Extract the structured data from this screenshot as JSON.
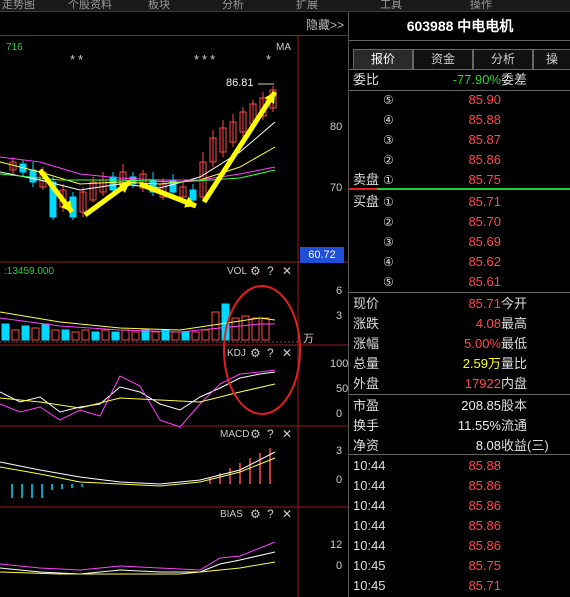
{
  "menu": [
    "走势图",
    "个股资料",
    "板块",
    "分析",
    "扩展",
    "工具",
    "操作"
  ],
  "header": {
    "hide_label": "隐藏>>"
  },
  "stock": {
    "code": "603988",
    "name": "中电电机"
  },
  "chart": {
    "ma_label": "MA",
    "ma_value": "716",
    "stars_left": "**",
    "stars_mid": "***",
    "stars_right": "*",
    "high_label": "86.81",
    "price_ticks": [
      "80",
      "70"
    ],
    "current_price_tag": "60.72",
    "vol_readout": ":13459.000",
    "vol_title": "VOL",
    "vol_ticks": [
      "6",
      "3"
    ],
    "vol_unit": "万",
    "kdj_title": "KDJ",
    "kdj_ticks": [
      "100",
      "50",
      "0"
    ],
    "macd_title": "MACD",
    "macd_ticks": [
      "3",
      "0"
    ],
    "bias_title": "BIAS",
    "bias_ticks": [
      "12",
      "0"
    ],
    "icons": {
      "settings": "⚙",
      "help": "?",
      "close": "✕"
    }
  },
  "tabs": [
    "报价",
    "资金",
    "分析",
    "操"
  ],
  "weibi": {
    "label": "委比",
    "value": "-77.90%",
    "label2": "委差"
  },
  "sell": [
    {
      "num": "⑤",
      "price": "85.90"
    },
    {
      "num": "④",
      "price": "85.88"
    },
    {
      "num": "③",
      "price": "85.87"
    },
    {
      "num": "②",
      "price": "85.86"
    },
    {
      "num": "①",
      "price": "85.75"
    }
  ],
  "sell_label": "卖盘",
  "buy_label": "买盘",
  "buy": [
    {
      "num": "①",
      "price": "85.71"
    },
    {
      "num": "②",
      "price": "85.70"
    },
    {
      "num": "③",
      "price": "85.69"
    },
    {
      "num": "④",
      "price": "85.62"
    },
    {
      "num": "⑤",
      "price": "85.61"
    }
  ],
  "stats": [
    {
      "label": "现价",
      "value": "85.71",
      "color": "red",
      "label2": "今开"
    },
    {
      "label": "涨跌",
      "value": "4.08",
      "color": "red",
      "label2": "最高"
    },
    {
      "label": "涨幅",
      "value": "5.00%",
      "color": "red",
      "label2": "最低"
    },
    {
      "label": "总量",
      "value": "2.59万",
      "color": "yellow",
      "label2": "量比"
    },
    {
      "label": "外盘",
      "value": "17922",
      "color": "red",
      "label2": "内盘"
    },
    {
      "label": "市盈",
      "value": "208.85",
      "color": "white",
      "label2": "股本"
    },
    {
      "label": "换手",
      "value": "11.55%",
      "color": "white",
      "label2": "流通"
    },
    {
      "label": "净资",
      "value": "8.08",
      "color": "white",
      "label2": "收益(三)"
    }
  ],
  "ticks": [
    {
      "time": "10:44",
      "price": "85.88"
    },
    {
      "time": "10:44",
      "price": "85.86"
    },
    {
      "time": "10:44",
      "price": "85.86"
    },
    {
      "time": "10:44",
      "price": "85.86"
    },
    {
      "time": "10:44",
      "price": "85.86"
    },
    {
      "time": "10:45",
      "price": "85.75"
    },
    {
      "time": "10:45",
      "price": "85.71"
    }
  ],
  "colors": {
    "up": "#ff4a4a",
    "down": "#00d8ff",
    "accent": "#ffff00",
    "circle": "#e02020"
  }
}
